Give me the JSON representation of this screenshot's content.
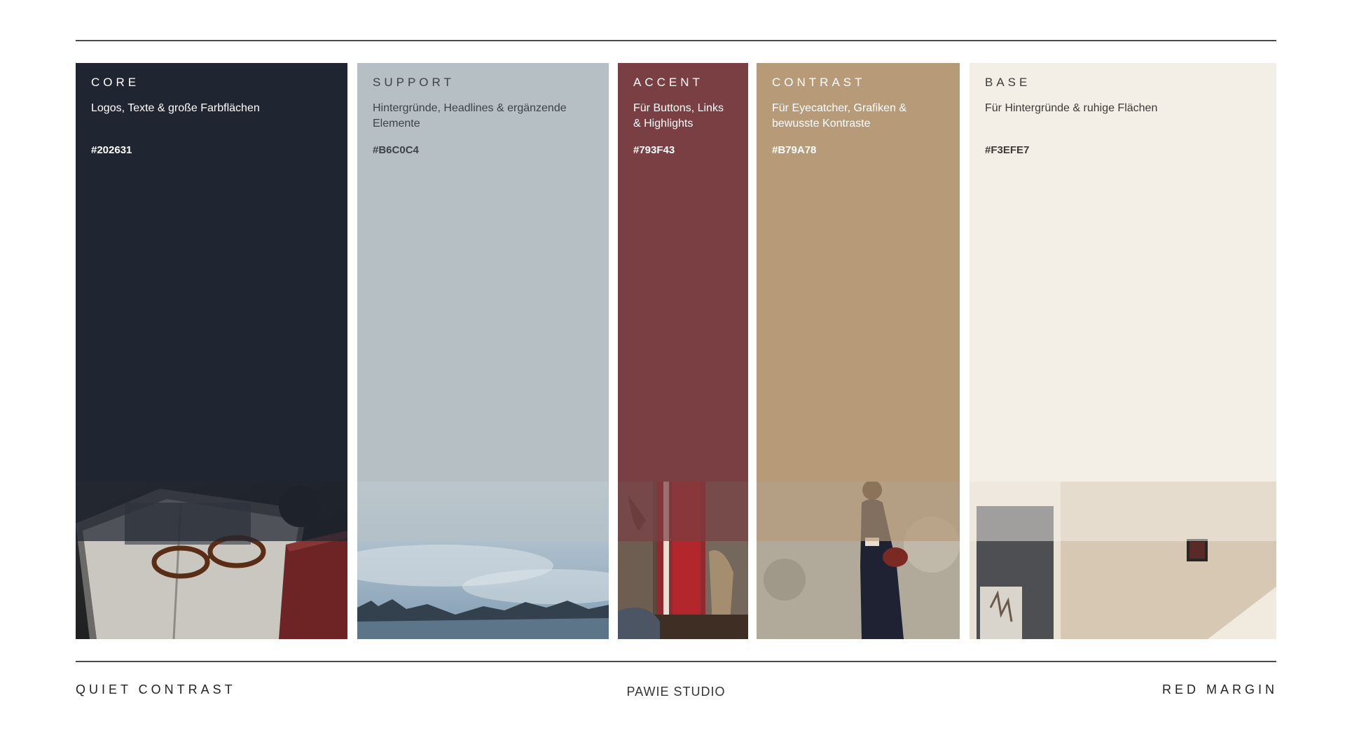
{
  "swatches": [
    {
      "label": "CORE",
      "desc": "Logos, Texte & große Farbflächen",
      "hex": "#202631",
      "color": "#202631",
      "text_color": "#ffffff",
      "photo": "book-with-glasses-photo"
    },
    {
      "label": "SUPPORT",
      "desc": "Hintergründe, Headlines & ergänzende Elemente",
      "hex": "#B6C0C4",
      "color": "#B6C0C4",
      "text_color": "#3d4246",
      "photo": "misty-forest-photo"
    },
    {
      "label": "ACCENT",
      "desc": "Für Buttons, Links & Highlights",
      "hex": "#793F43",
      "color": "#793F43",
      "text_color": "#ffffff",
      "photo": "red-door-interior-photo"
    },
    {
      "label": "CONTRAST",
      "desc": "Für Eyecatcher, Grafiken & bewusste Kontraste",
      "hex": "#B79A78",
      "color": "#B79A78",
      "text_color": "#ffffff",
      "photo": "woman-reading-photo"
    },
    {
      "label": "BASE",
      "desc": "Für Hintergründe & ruhige Flächen",
      "hex": "#F3EFE7",
      "color": "#F3EFE7",
      "text_color": "#3d3a36",
      "photo": "beige-room-photo"
    }
  ],
  "footer": {
    "left": "QUIET CONTRAST",
    "center": "PAWIE STUDIO",
    "right": "RED MARGIN"
  }
}
